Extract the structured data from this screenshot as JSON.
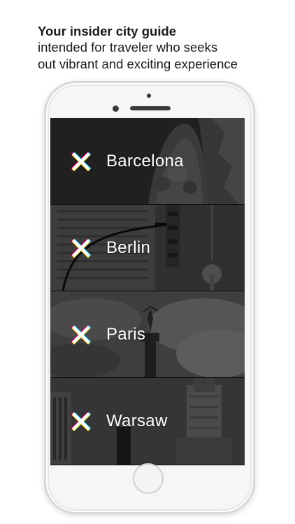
{
  "caption": {
    "title": "Your insider city guide",
    "line1": "intended for traveler who seeks",
    "line2": "out vibrant and exciting experience"
  },
  "cities": [
    {
      "label": "Barcelona",
      "icon": "x-logo-icon"
    },
    {
      "label": "Berlin",
      "icon": "x-logo-icon"
    },
    {
      "label": "Paris",
      "icon": "x-logo-icon"
    },
    {
      "label": "Warsaw",
      "icon": "x-logo-icon"
    }
  ],
  "colors": {
    "icon_white": "#ffffff",
    "icon_magenta": "#e4007c",
    "icon_cyan": "#00b8e6",
    "icon_yellow": "#ffe600"
  }
}
